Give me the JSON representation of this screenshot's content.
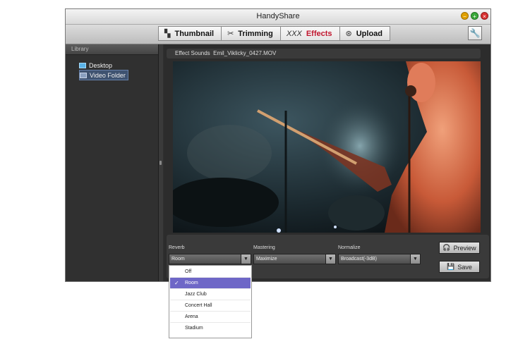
{
  "window": {
    "title": "HandyShare"
  },
  "toolbar": {
    "tabs": [
      {
        "label": "Thumbnail",
        "icon": "thumbnail-icon"
      },
      {
        "label": "Trimming",
        "icon": "trimming-icon"
      },
      {
        "label": "Effects",
        "icon": "effects-icon",
        "active": true
      },
      {
        "label": "Upload",
        "icon": "upload-icon"
      }
    ],
    "settings_icon": "wrench-icon"
  },
  "sidebar": {
    "header": "Library",
    "items": [
      {
        "label": "Desktop",
        "icon": "desktop-icon"
      },
      {
        "label": "Video Folder",
        "icon": "video-folder-icon",
        "selected": true
      }
    ]
  },
  "main": {
    "file_label": "Effect Sounds",
    "file_name": "Emil_Viklicky_0427.MOV"
  },
  "controls": {
    "reverb": {
      "label": "Reverb",
      "value": "Room"
    },
    "mastering": {
      "label": "Mastering",
      "value": "Maximize"
    },
    "normalize": {
      "label": "Normalize",
      "value": "Broadcast(-3dB)"
    },
    "preview_label": "Preview",
    "save_label": "Save"
  },
  "reverb_options": [
    "Off",
    "Room",
    "Jazz Club",
    "Concert Hall",
    "Arena",
    "Stadium"
  ],
  "reverb_selected": "Room",
  "colors": {
    "active_tab": "#c0162e",
    "selection": "#6e67c7"
  }
}
